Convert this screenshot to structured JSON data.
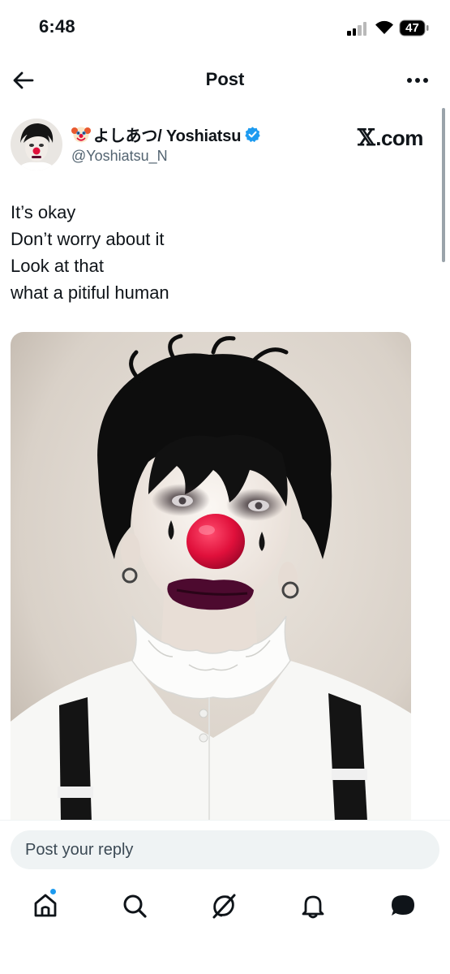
{
  "status": {
    "time": "6:48",
    "battery": "47"
  },
  "nav": {
    "title": "Post"
  },
  "author": {
    "display_name": "よしあつ/ Yoshiatsu",
    "handle": "@Yoshiatsu_N",
    "verified": true,
    "name_emoji": "clown-face-icon"
  },
  "watermark": {
    "x": "𝕏",
    "rest": ".com"
  },
  "tweet": {
    "lines": [
      "It’s okay",
      "Don’t worry about it",
      "Look at that",
      "what a pitiful human"
    ]
  },
  "reply": {
    "placeholder": "Post your reply"
  },
  "tabbar": {
    "items": [
      "home-icon",
      "search-icon",
      "grok-icon",
      "notifications-icon",
      "messages-icon"
    ],
    "home_has_dot": true
  },
  "colors": {
    "accent": "#1d9bf0",
    "text": "#0f1419",
    "secondary": "#536471",
    "input_bg": "#eff3f4"
  }
}
